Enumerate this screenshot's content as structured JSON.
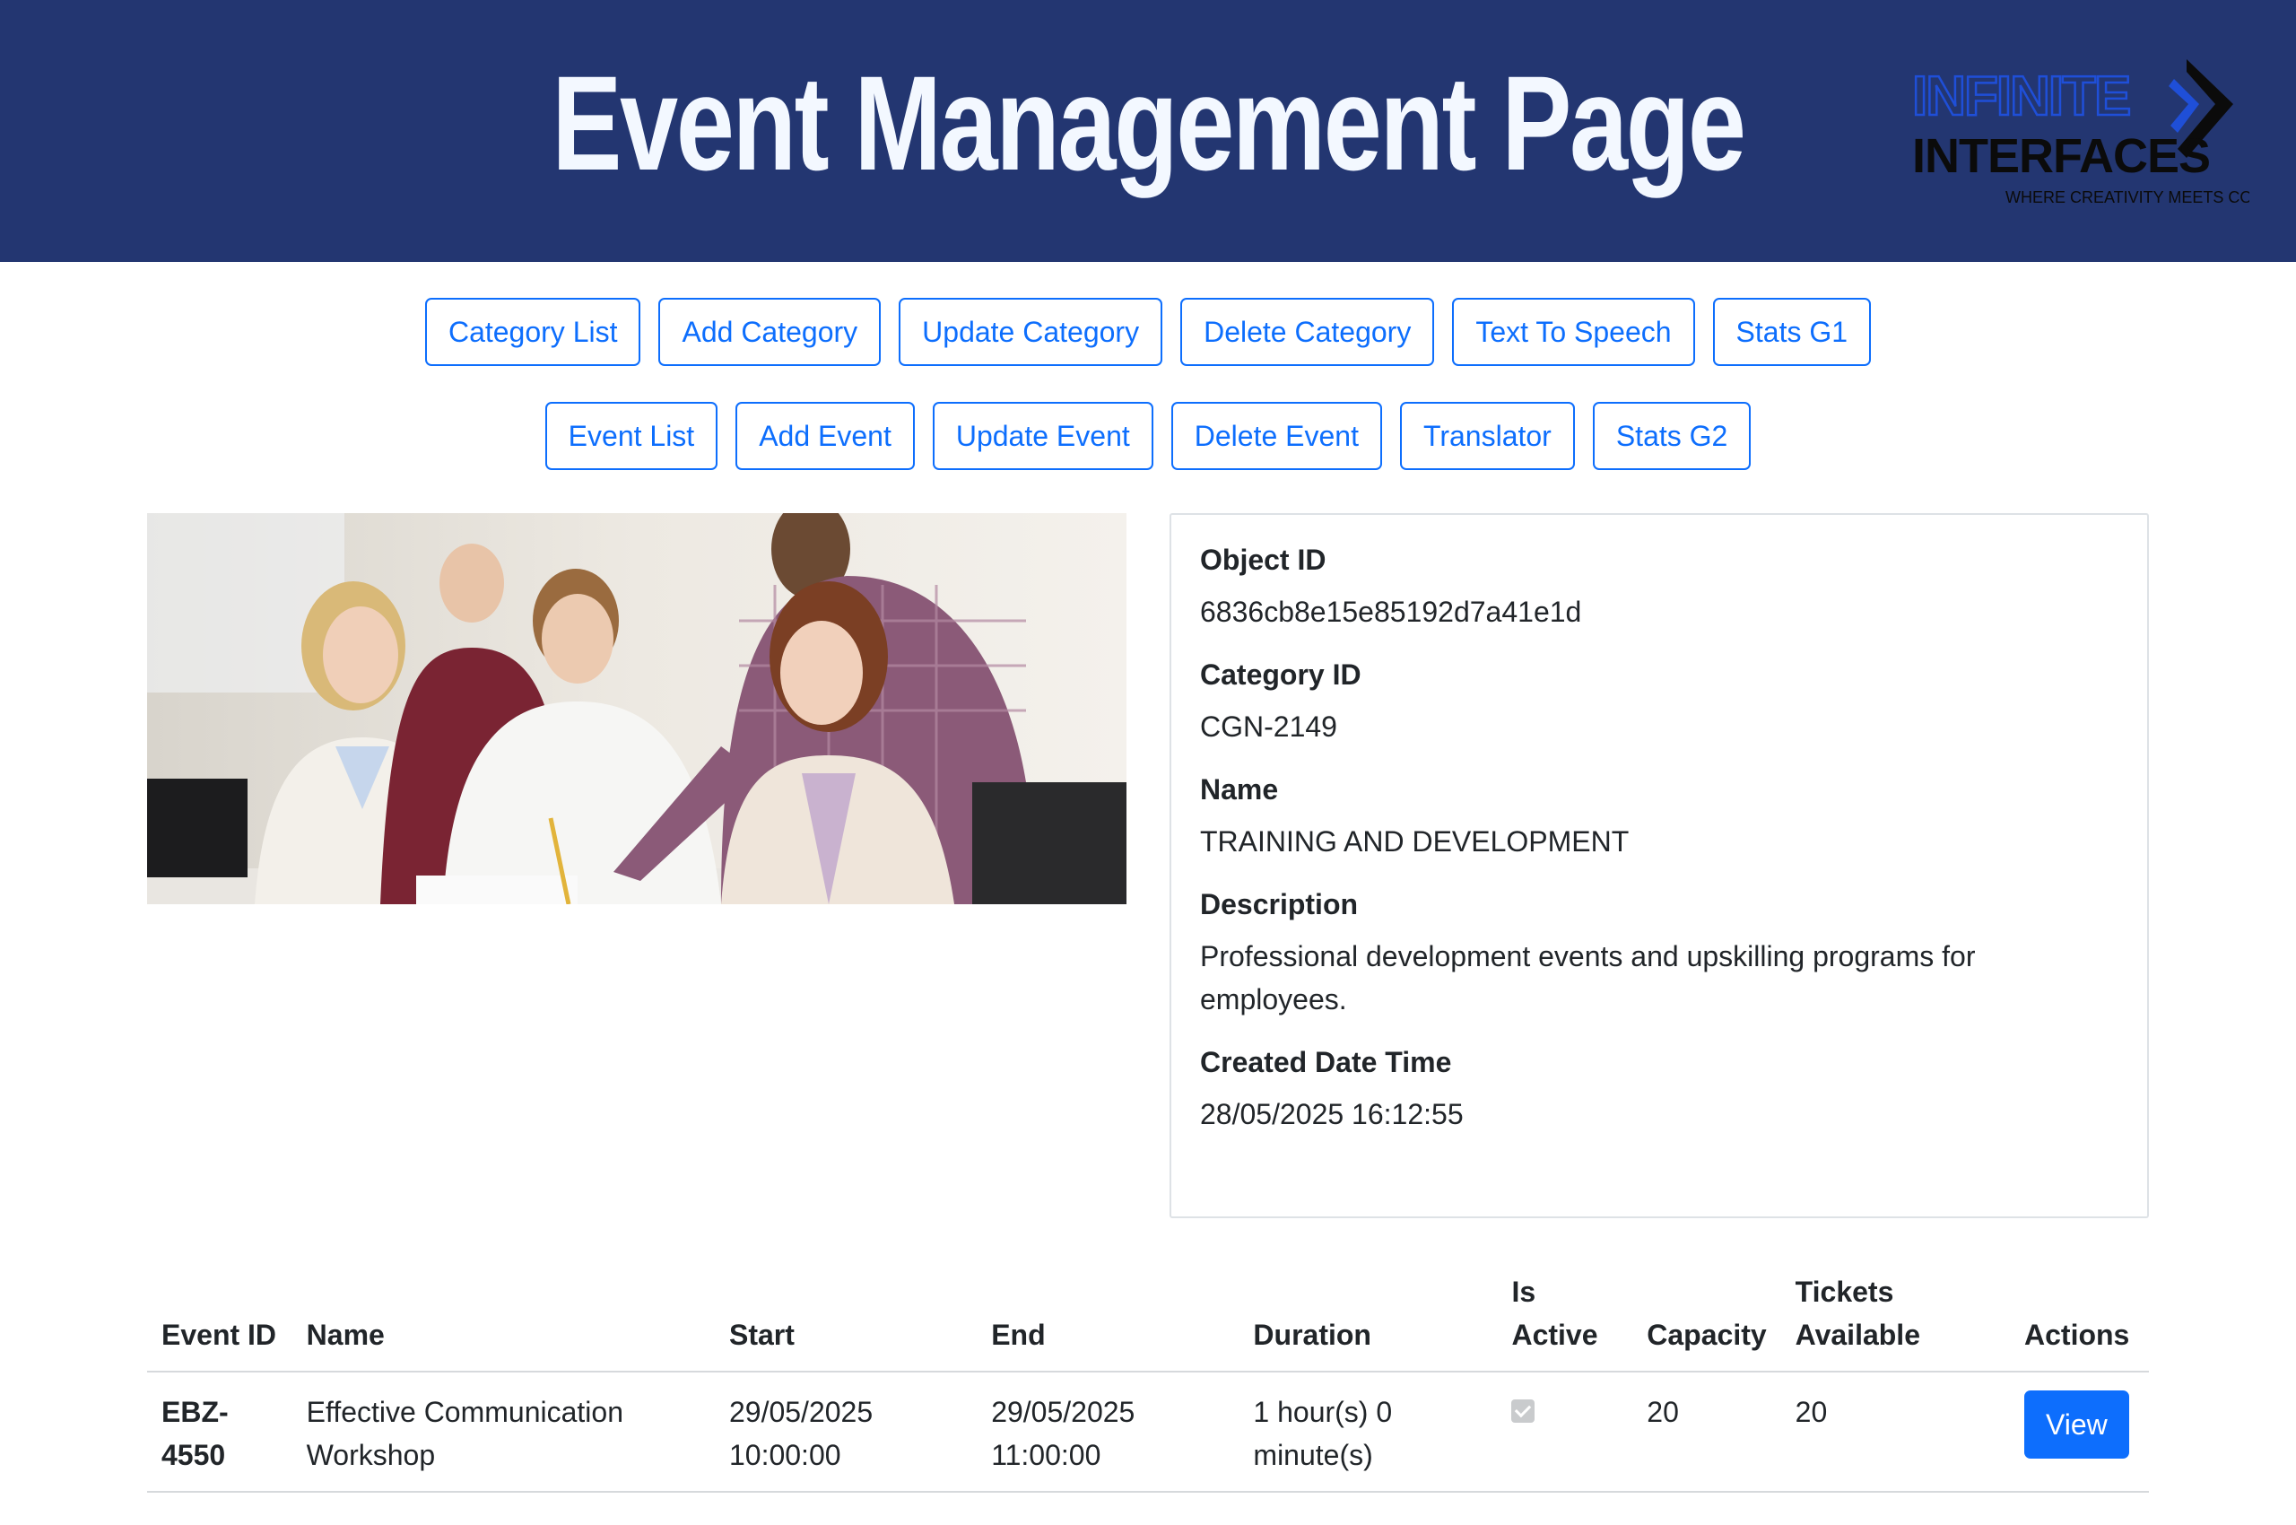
{
  "header": {
    "title": "Event Management Page",
    "logo": {
      "line1": "INFINITE",
      "line2": "INTERFACES",
      "tagline": "WHERE CREATIVITY MEETS CODE"
    }
  },
  "nav": {
    "row1": [
      {
        "label": "Category List"
      },
      {
        "label": "Add Category"
      },
      {
        "label": "Update Category"
      },
      {
        "label": "Delete Category"
      },
      {
        "label": "Text To Speech"
      },
      {
        "label": "Stats G1"
      }
    ],
    "row2": [
      {
        "label": "Event List"
      },
      {
        "label": "Add Event"
      },
      {
        "label": "Update Event"
      },
      {
        "label": "Delete Event"
      },
      {
        "label": "Translator"
      },
      {
        "label": "Stats G2"
      }
    ]
  },
  "image": {
    "icon": "team-meeting-photo"
  },
  "category": {
    "fields": [
      {
        "label": "Object ID",
        "value": "6836cb8e15e85192d7a41e1d"
      },
      {
        "label": "Category ID",
        "value": "CGN-2149"
      },
      {
        "label": "Name",
        "value": "TRAINING AND DEVELOPMENT"
      },
      {
        "label": "Description",
        "value": "Professional development events and upskilling programs for employees."
      },
      {
        "label": "Created Date Time",
        "value": "28/05/2025 16:12:55"
      }
    ]
  },
  "events_table": {
    "columns": [
      "Event ID",
      "Name",
      "Start",
      "End",
      "Duration",
      "Is Active",
      "Capacity",
      "Tickets Available",
      "Actions"
    ],
    "rows": [
      {
        "event_id": "EBZ-4550",
        "name": "Effective Communication Workshop",
        "start": "29/05/2025 10:00:00",
        "end": "29/05/2025 11:00:00",
        "duration": "1 hour(s) 0 minute(s)",
        "is_active": true,
        "capacity": "20",
        "tickets_available": "20",
        "action_label": "View"
      }
    ]
  },
  "colors": {
    "header_bg": "#233671",
    "primary": "#0d6efd",
    "logo_blue": "#1f4fd8"
  }
}
